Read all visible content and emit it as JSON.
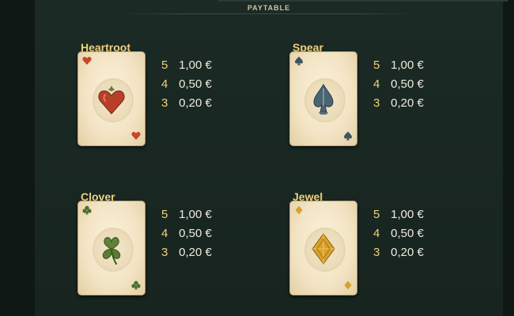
{
  "paytable": {
    "title": "PAYTABLE",
    "symbols": [
      {
        "name": "Heartroot",
        "icon": "heart-icon",
        "payouts": [
          {
            "count": "5",
            "value": "1,00 €"
          },
          {
            "count": "4",
            "value": "0,50 €"
          },
          {
            "count": "3",
            "value": "0,20 €"
          }
        ]
      },
      {
        "name": "Spear",
        "icon": "spade-icon",
        "payouts": [
          {
            "count": "5",
            "value": "1,00 €"
          },
          {
            "count": "4",
            "value": "0,50 €"
          },
          {
            "count": "3",
            "value": "0,20 €"
          }
        ]
      },
      {
        "name": "Clover",
        "icon": "clover-icon",
        "payouts": [
          {
            "count": "5",
            "value": "1,00 €"
          },
          {
            "count": "4",
            "value": "0,50 €"
          },
          {
            "count": "3",
            "value": "0,20 €"
          }
        ]
      },
      {
        "name": "Jewel",
        "icon": "diamond-icon",
        "payouts": [
          {
            "count": "5",
            "value": "1,00 €"
          },
          {
            "count": "4",
            "value": "0,50 €"
          },
          {
            "count": "3",
            "value": "0,20 €"
          }
        ]
      }
    ]
  },
  "colors": {
    "accent_gold": "#f0d27a",
    "panel_bg": "#1a2824",
    "card_face": "#f2e3c3",
    "heart_red": "#c8472a",
    "spade_blue": "#3e5561",
    "clover_green": "#4d6e2f",
    "diamond_gold": "#d9a12a"
  }
}
